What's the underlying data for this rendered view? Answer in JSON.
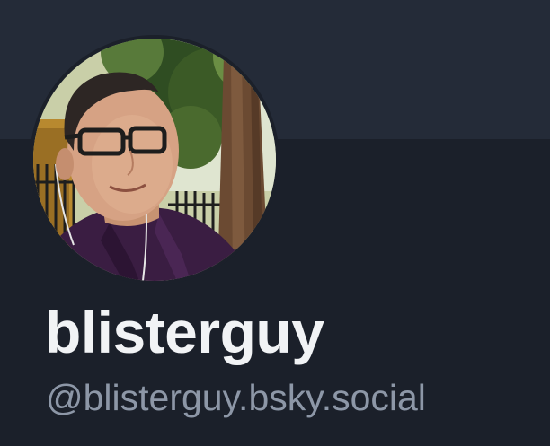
{
  "profile": {
    "display_name": "blisterguy",
    "handle": "@blisterguy.bsky.social",
    "avatar_icon": "user-avatar-photo"
  },
  "colors": {
    "banner": "#242b38",
    "background": "#1b202a",
    "display_name": "#f1f3f5",
    "handle": "#8d97a7"
  }
}
